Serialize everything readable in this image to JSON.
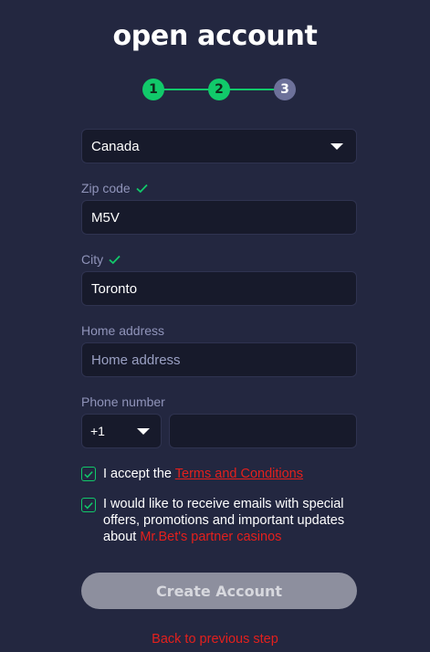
{
  "title": "open account",
  "steps": [
    "1",
    "2",
    "3"
  ],
  "country": {
    "value": "Canada"
  },
  "zip": {
    "label": "Zip code",
    "value": "M5V"
  },
  "city": {
    "label": "City",
    "value": "Toronto"
  },
  "address": {
    "label": "Home address",
    "placeholder": "Home address",
    "value": ""
  },
  "phone": {
    "label": "Phone number",
    "code": "+1",
    "number": ""
  },
  "terms": {
    "prefix": "I accept the",
    "link": "Terms and Conditions"
  },
  "emails": {
    "text": "I would like to receive emails with special offers, promotions and important updates about",
    "link": "Mr.Bet's partner casinos"
  },
  "create_button": "Create Account",
  "back_link": "Back to previous step",
  "colors": {
    "accent_green": "#11c96a",
    "link_red": "#e3201d",
    "background": "#232740"
  }
}
